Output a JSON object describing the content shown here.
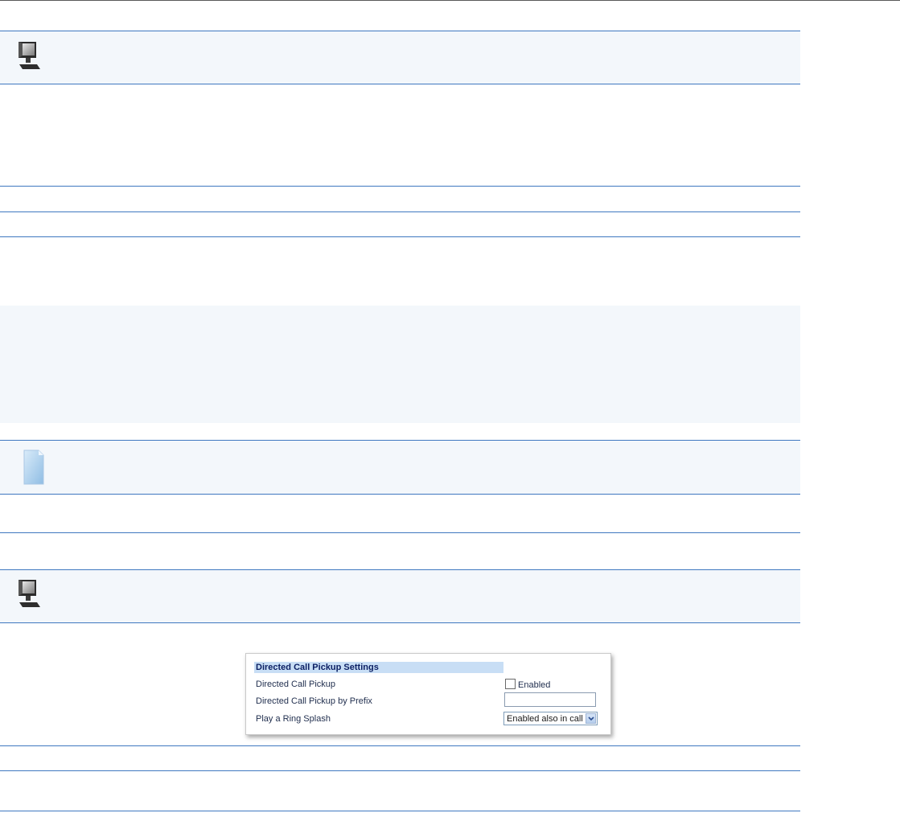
{
  "icons": {
    "note_top": "computer-monitor-icon",
    "note_middle": "document-page-icon",
    "note_bottom": "computer-monitor-icon"
  },
  "dialog": {
    "header": "Directed Call Pickup Settings",
    "rows": {
      "pickup_label": "Directed Call Pickup",
      "pickup_checkbox_label": "Enabled",
      "prefix_label": "Directed Call Pickup by Prefix",
      "prefix_value": "",
      "ring_splash_label": "Play a Ring Splash",
      "ring_splash_value": "Enabled also in call"
    }
  },
  "colors": {
    "rule": "#3f78c0",
    "band": "#f3f7fb",
    "dialog_header": "#c8def5"
  }
}
